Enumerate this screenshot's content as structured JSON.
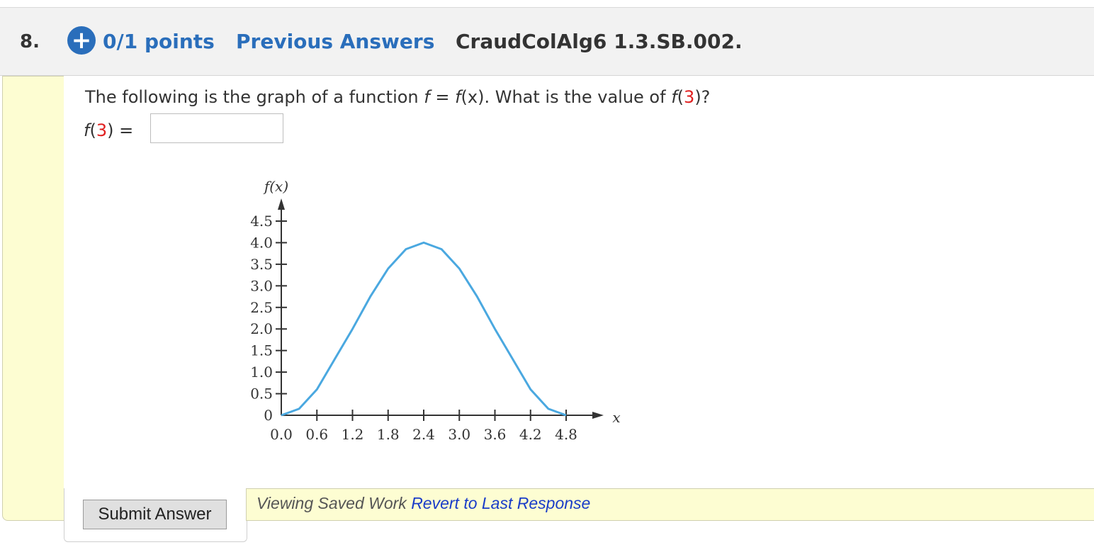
{
  "header": {
    "question_number": "8.",
    "plus_icon": "+",
    "points": "0/1 points",
    "previous_answers": "Previous Answers",
    "question_id": "CraudColAlg6 1.3.SB.002."
  },
  "question": {
    "text_before": "The following is the graph of a function ",
    "f1": "f",
    "eq": " = ",
    "f2": "f",
    "x_paren": "(x)",
    "text_mid": ". What is the value of ",
    "f3": "f",
    "open_paren": "(",
    "arg": "3",
    "close_q": ")?",
    "answer_f": "f",
    "answer_open": "(",
    "answer_arg": "3",
    "answer_close": ") =",
    "answer_value": ""
  },
  "chart_data": {
    "type": "line",
    "ylabel": "f(x)",
    "xlabel": "x",
    "x_ticks": [
      "0.0",
      "0.6",
      "1.2",
      "1.8",
      "2.4",
      "3.0",
      "3.6",
      "4.2",
      "4.8"
    ],
    "y_ticks": [
      "0",
      "0.5",
      "1.0",
      "1.5",
      "2.0",
      "2.5",
      "3.0",
      "3.5",
      "4.0",
      "4.5"
    ],
    "xlim": [
      0,
      4.8
    ],
    "ylim": [
      0,
      4.5
    ],
    "series": [
      {
        "color": "#4aa8e0",
        "x": [
          0.0,
          0.3,
          0.6,
          0.9,
          1.2,
          1.5,
          1.8,
          2.1,
          2.4,
          2.7,
          3.0,
          3.3,
          3.6,
          3.9,
          4.2,
          4.5,
          4.8
        ],
        "y": [
          0.0,
          0.15,
          0.6,
          1.3,
          2.0,
          2.75,
          3.4,
          3.85,
          4.0,
          3.85,
          3.4,
          2.75,
          2.0,
          1.3,
          0.6,
          0.15,
          0.0
        ]
      }
    ]
  },
  "footer": {
    "submit_label": "Submit Answer",
    "viewing_saved": "Viewing Saved Work ",
    "revert_label": "Revert to Last Response"
  }
}
